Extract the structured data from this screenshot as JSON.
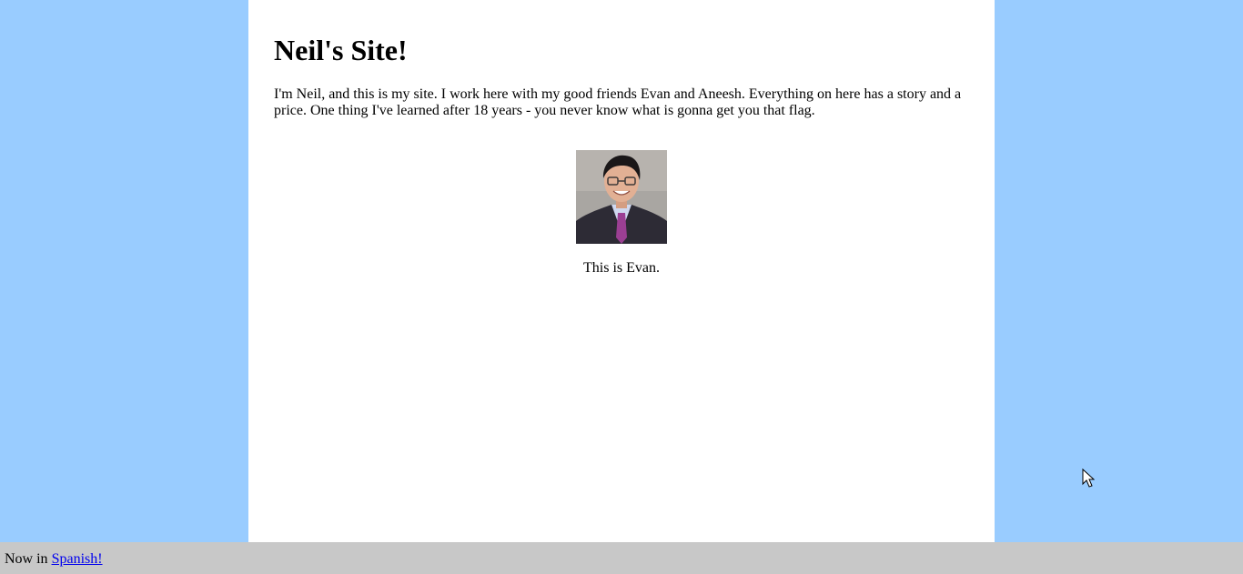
{
  "page": {
    "title": "Neil's Site!",
    "intro": "I'm Neil, and this is my site. I work here with my good friends Evan and Aneesh. Everything on here has a story and a price. One thing I've learned after 18 years - you never know what is gonna get you that flag.",
    "photo_alt": "Evan",
    "caption": "This is Evan."
  },
  "footer": {
    "prefix": "Now in ",
    "link_label": "Spanish!"
  },
  "colors": {
    "side_background": "#99ccff",
    "content_background": "#ffffff",
    "footer_background": "#c8c8c8",
    "link": "#0000ee"
  },
  "icons": {
    "cursor": "mouse-pointer-icon"
  }
}
